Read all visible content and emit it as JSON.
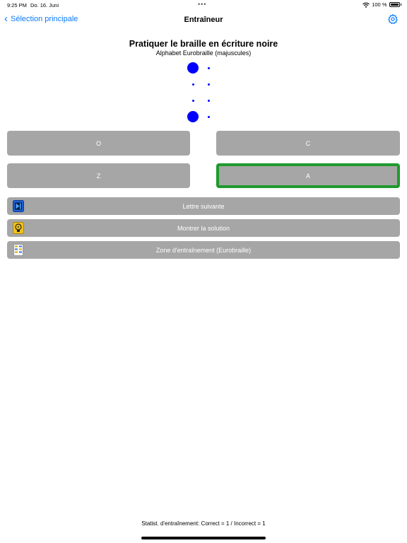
{
  "status_bar": {
    "time": "9:25 PM",
    "date": "Do. 16. Juni",
    "dots": "•••",
    "battery": "100 %",
    "battery_level": 1.0
  },
  "nav": {
    "back_label": "Sélection principale",
    "title": "Entraîneur",
    "back_icon": "chevron-left-icon",
    "settings_icon": "gear-icon"
  },
  "header": {
    "title": "Pratiquer le braille en écriture noire",
    "subtitle": "Alphabet Eurobraille (majuscules)"
  },
  "braille_cell": {
    "raised_dots": [
      1,
      7
    ],
    "dot_color": "#0000ff"
  },
  "choices": [
    {
      "label": "O",
      "selected": false
    },
    {
      "label": "C",
      "selected": false
    },
    {
      "label": "Z",
      "selected": false
    },
    {
      "label": "A",
      "selected": true
    }
  ],
  "actions": [
    {
      "label": "Lettre suivante",
      "icon": "next-track-icon"
    },
    {
      "label": "Montrer la solution",
      "icon": "lightbulb-icon"
    },
    {
      "label": "Zone d'entraînement (Eurobraille)",
      "icon": "braille-chart-icon"
    }
  ],
  "stats": "Statist. d'entraînement: Correct = 1 / Incorrect = 1",
  "colors": {
    "accent": "#0a7aff",
    "button": "#a6a6a6",
    "selected_border": "#1f9a2e"
  }
}
